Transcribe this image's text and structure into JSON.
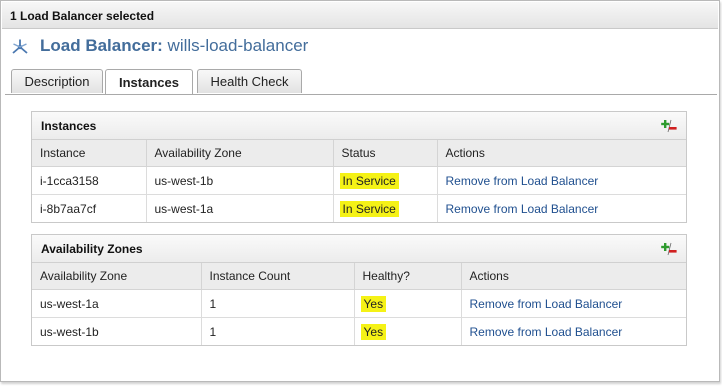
{
  "selection_bar": {
    "text": "1 Load Balancer selected"
  },
  "header": {
    "title_prefix": "Load Balancer:",
    "title_name": "wills-load-balancer",
    "icon": "load-balancer-icon"
  },
  "tabs": [
    {
      "label": "Description",
      "active": false
    },
    {
      "label": "Instances",
      "active": true
    },
    {
      "label": "Health Check",
      "active": false
    }
  ],
  "instances_panel": {
    "title": "Instances",
    "icon": "add-remove-icon",
    "columns": [
      "Instance",
      "Availability Zone",
      "Status",
      "Actions"
    ],
    "rows": [
      {
        "instance": "i-1cca3158",
        "zone": "us-west-1b",
        "status": "In Service",
        "action": "Remove from Load Balancer"
      },
      {
        "instance": "i-8b7aa7cf",
        "zone": "us-west-1a",
        "status": "In Service",
        "action": "Remove from Load Balancer"
      }
    ]
  },
  "zones_panel": {
    "title": "Availability Zones",
    "icon": "add-remove-icon",
    "columns": [
      "Availability Zone",
      "Instance Count",
      "Healthy?",
      "Actions"
    ],
    "rows": [
      {
        "zone": "us-west-1a",
        "count": "1",
        "healthy": "Yes",
        "action": "Remove from Load Balancer"
      },
      {
        "zone": "us-west-1b",
        "count": "1",
        "healthy": "Yes",
        "action": "Remove from Load Balancer"
      }
    ]
  },
  "colors": {
    "title_blue": "#436d9b",
    "link_blue": "#1f4f8f",
    "highlight_yellow": "#f5f216"
  }
}
